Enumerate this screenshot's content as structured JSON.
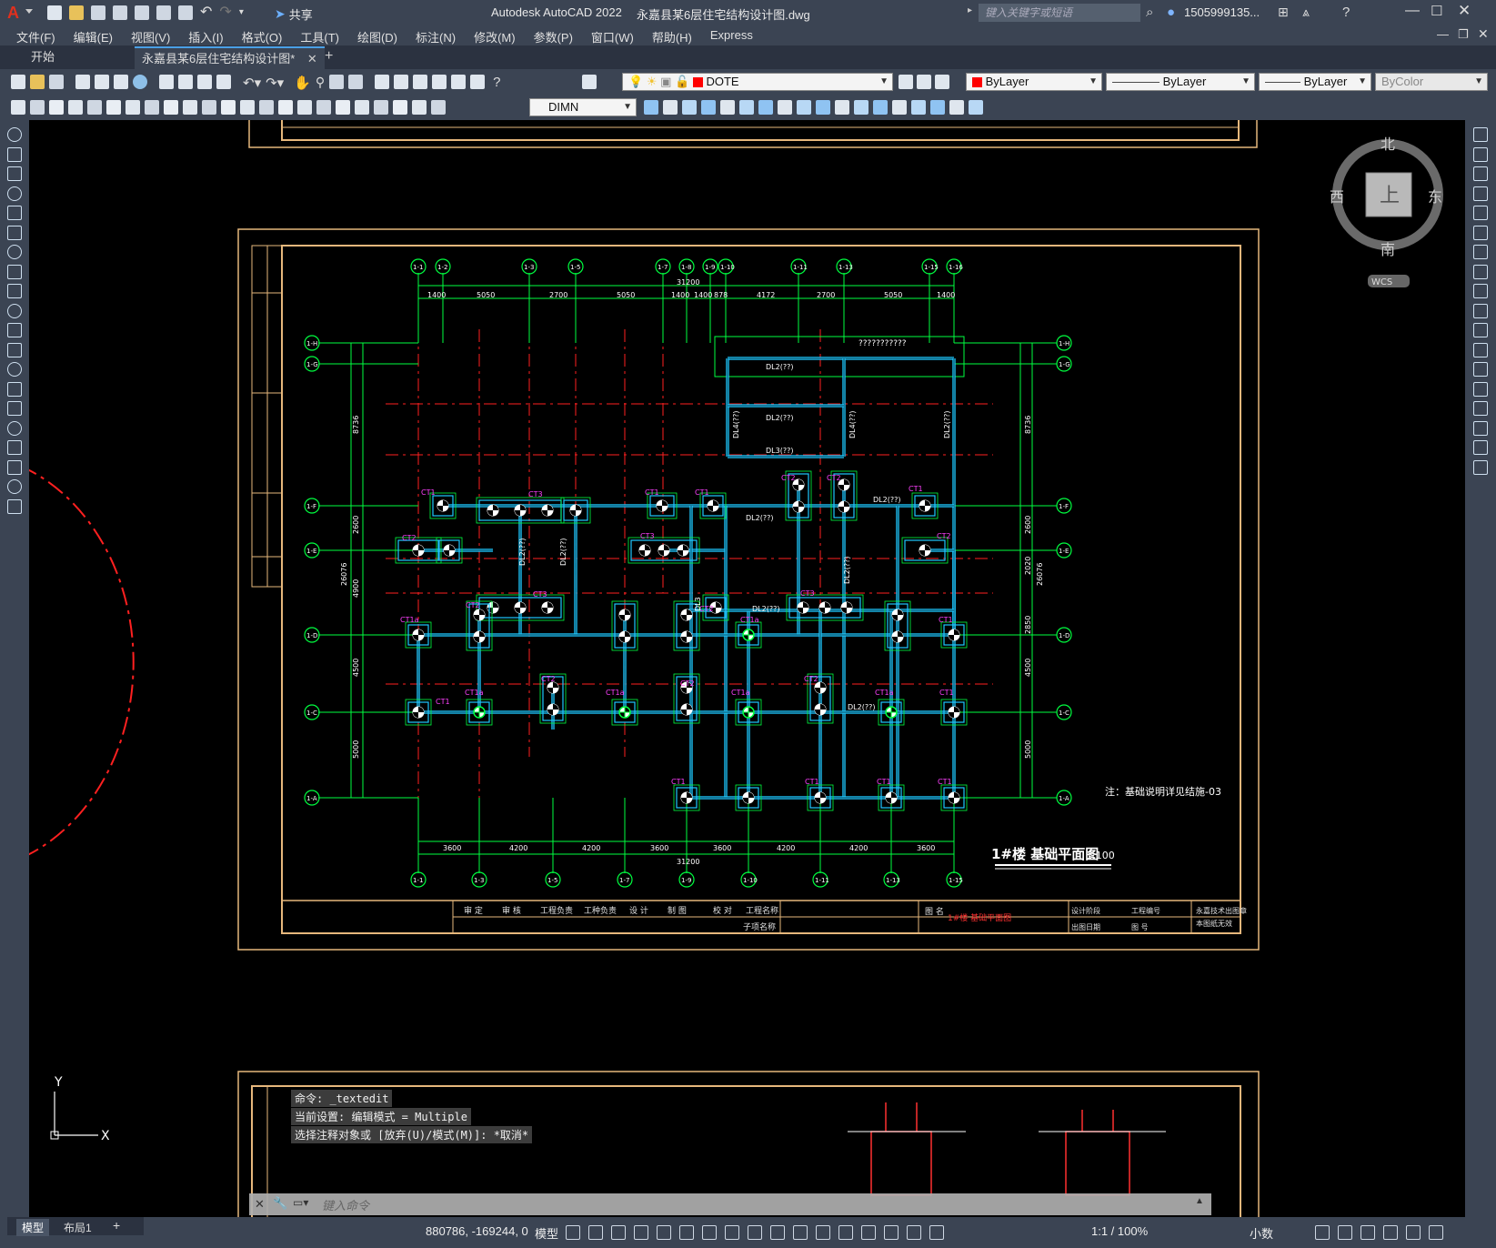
{
  "app": {
    "title": "Autodesk AutoCAD 2022",
    "file": "永嘉县某6层住宅结构设计图.dwg",
    "search_placeholder": "键入关键字或短语",
    "user": "1505999135...",
    "share": "共享"
  },
  "menu": [
    "文件(F)",
    "编辑(E)",
    "视图(V)",
    "插入(I)",
    "格式(O)",
    "工具(T)",
    "绘图(D)",
    "标注(N)",
    "修改(M)",
    "参数(P)",
    "窗口(W)",
    "帮助(H)",
    "Express"
  ],
  "tabs": [
    {
      "label": "开始",
      "active": false
    },
    {
      "label": "永嘉县某6层住宅结构设计图*",
      "active": true
    }
  ],
  "layer": {
    "name": "DOTE",
    "color": "#ff0000"
  },
  "properties": {
    "color": "ByLayer",
    "linetype": "ByLayer",
    "lineweight": "ByLayer",
    "plotstyle": "ByColor"
  },
  "dimstyle": "DIMN",
  "viewcube": {
    "north": "北",
    "south": "南",
    "east": "东",
    "west": "西",
    "top": "上",
    "wcs": "WCS"
  },
  "drawing": {
    "title": "1#楼 基础平面图",
    "scale": "1:100",
    "note": "注：基础说明详见结施-03",
    "top_total": "31200",
    "bottom_total": "31200",
    "top_dims": [
      "1400",
      "5050",
      "2700",
      "5050",
      "1400",
      "1400",
      "878",
      "4172",
      "2700",
      "5050",
      "1400"
    ],
    "bottom_dims": [
      "3600",
      "4200",
      "4200",
      "3600",
      "3600",
      "4200",
      "4200",
      "3600"
    ],
    "left_dims": [
      "8736",
      "2600",
      "4900",
      "4500",
      "5000"
    ],
    "right_dims": [
      "8736",
      "2600",
      "2020",
      "2850",
      "4500",
      "5000"
    ],
    "total_left": "26076",
    "total_right": "26076",
    "top_axes": [
      "1-1",
      "1-2",
      "1-3",
      "1-5",
      "1-7",
      "1-8",
      "1-9",
      "1-10",
      "1-11",
      "1-13",
      "1-15",
      "1-16"
    ],
    "bottom_axes": [
      "1-1",
      "1-3",
      "1-5",
      "1-7",
      "1-9",
      "1-10",
      "1-11",
      "1-13",
      "1-15",
      "1-16"
    ],
    "left_axes": [
      "1-H",
      "1-G",
      "1-F",
      "1-E",
      "1-D",
      "1-C",
      "1-A"
    ],
    "right_axes": [
      "1-H",
      "1-G",
      "1-F",
      "1-E",
      "1-D",
      "1-C",
      "1-A"
    ],
    "hidden_text": "???????????",
    "beam_labels": [
      "DL2(??)",
      "DL2(??)",
      "DL3(??)",
      "DL4(??)",
      "DL4(??)",
      "DL2(??)",
      "DL2(??)",
      "DL2(??)",
      "DL2(??)",
      "DL2(??)",
      "DL2(??)",
      "DL3",
      "DL2(??)",
      "DL2(??)"
    ],
    "caps": [
      "CT1",
      "CT2",
      "CT3",
      "CT1a"
    ],
    "titleblock": {
      "row1": [
        "审 定",
        "审 核",
        "工程负责",
        "工种负责",
        "设 计",
        "制 图",
        "校 对",
        "工程名称"
      ],
      "row2": "子项名称",
      "drawing_name": "1#楼 基础平面图",
      "tuming": "图 名",
      "c1": "设计阶段",
      "c2": "出图日期",
      "c3": "工程编号",
      "c4": "图 号",
      "stamp": "永嘉技术出图章",
      "stamp2": "本图纸无效"
    }
  },
  "command": {
    "history": [
      "命令: _textedit",
      "当前设置: 编辑模式 = Multiple",
      "选择注释对象或 [放弃(U)/模式(M)]: *取消*"
    ],
    "prompt": "键入命令"
  },
  "status": {
    "coords": "880786, -169244, 0",
    "model": "模型",
    "scale": "1:1 / 100%",
    "units": "小数",
    "layout_tabs": [
      "模型",
      "布局1"
    ]
  },
  "ucs": {
    "y": "Y",
    "x": "X"
  }
}
